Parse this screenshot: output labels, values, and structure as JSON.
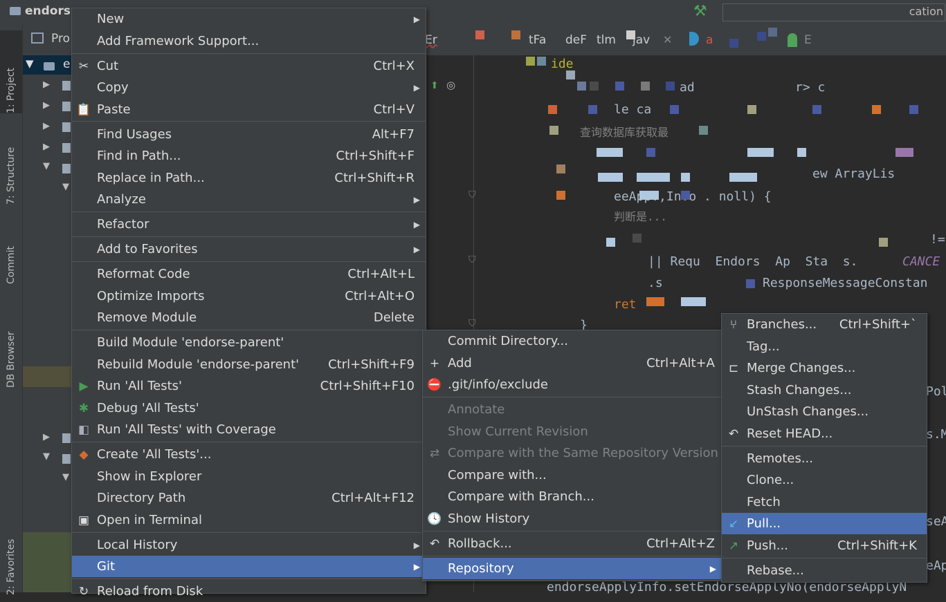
{
  "titlebar": {
    "project_name": "endors",
    "run_config": "cation"
  },
  "tool_strip": {
    "project": "1: Project",
    "structure": "7: Structure",
    "commit": "Commit",
    "db_browser": "DB Browser",
    "favorites": "2: Favorites"
  },
  "project_panel": {
    "header": "Pro",
    "root": "e"
  },
  "editor": {
    "tabs": [
      "Er",
      "tFa",
      "deF",
      "tlm",
      "jav",
      "a",
      "E"
    ],
    "lines": {
      "override": "ide",
      "l1": "ad",
      "l1b": "r> c",
      "l2": "le ca",
      "l3": "查询数据库获取最",
      "l4": "ew ArrayLis",
      "l5": "eeApp.,In.o . noll) {",
      "l6": "判断是...",
      "l7": "!=",
      "l8": "|| Requ  Endors  Ap  Sta  s.",
      "l8c": "CANCE",
      "l9": ".s",
      "l9b": "ResponseMessageConstan",
      "l10": "ret",
      "l11": "}",
      "r1": "Pol",
      "r2": "s.M",
      "r3": "seAp",
      "r4": "eAp",
      "last": "endorseApplyInfo.setEndorseApplyNo(endorseApplyN"
    }
  },
  "context_menu": {
    "items": [
      {
        "label": "New"
      },
      {
        "label": "Add Framework Support..."
      },
      {
        "label": "Cut",
        "shortcut": "Ctrl+X"
      },
      {
        "label": "Copy"
      },
      {
        "label": "Paste",
        "shortcut": "Ctrl+V"
      },
      {
        "label": "Find Usages",
        "shortcut": "Alt+F7"
      },
      {
        "label": "Find in Path...",
        "shortcut": "Ctrl+Shift+F"
      },
      {
        "label": "Replace in Path...",
        "shortcut": "Ctrl+Shift+R"
      },
      {
        "label": "Analyze"
      },
      {
        "label": "Refactor"
      },
      {
        "label": "Add to Favorites"
      },
      {
        "label": "Reformat Code",
        "shortcut": "Ctrl+Alt+L"
      },
      {
        "label": "Optimize Imports",
        "shortcut": "Ctrl+Alt+O"
      },
      {
        "label": "Remove Module",
        "shortcut": "Delete"
      },
      {
        "label": "Build Module 'endorse-parent'"
      },
      {
        "label": "Rebuild Module 'endorse-parent'",
        "shortcut": "Ctrl+Shift+F9"
      },
      {
        "label": "Run 'All Tests'",
        "shortcut": "Ctrl+Shift+F10"
      },
      {
        "label": "Debug 'All Tests'"
      },
      {
        "label": "Run 'All Tests' with Coverage"
      },
      {
        "label": "Create 'All Tests'..."
      },
      {
        "label": "Show in Explorer"
      },
      {
        "label": "Directory Path",
        "shortcut": "Ctrl+Alt+F12"
      },
      {
        "label": "Open in Terminal"
      },
      {
        "label": "Local History"
      },
      {
        "label": "Git"
      },
      {
        "label": "Reload from Disk"
      }
    ]
  },
  "git_menu": {
    "items": [
      {
        "label": "Commit Directory..."
      },
      {
        "label": "Add",
        "shortcut": "Ctrl+Alt+A"
      },
      {
        "label": ".git/info/exclude"
      },
      {
        "label": "Annotate"
      },
      {
        "label": "Show Current Revision"
      },
      {
        "label": "Compare with the Same Repository Version"
      },
      {
        "label": "Compare with..."
      },
      {
        "label": "Compare with Branch..."
      },
      {
        "label": "Show History"
      },
      {
        "label": "Rollback...",
        "shortcut": "Ctrl+Alt+Z"
      },
      {
        "label": "Repository"
      }
    ]
  },
  "repository_menu": {
    "items": [
      {
        "label": "Branches...",
        "shortcut": "Ctrl+Shift+`"
      },
      {
        "label": "Tag..."
      },
      {
        "label": "Merge Changes..."
      },
      {
        "label": "Stash Changes..."
      },
      {
        "label": "UnStash Changes..."
      },
      {
        "label": "Reset HEAD..."
      },
      {
        "label": "Remotes..."
      },
      {
        "label": "Clone..."
      },
      {
        "label": "Fetch"
      },
      {
        "label": "Pull..."
      },
      {
        "label": "Push...",
        "shortcut": "Ctrl+Shift+K"
      },
      {
        "label": "Rebase..."
      }
    ]
  },
  "colors": {
    "selection": "#4b6eaf",
    "menu_bg": "#3c3f41",
    "editor_bg": "#2b2b2b"
  }
}
